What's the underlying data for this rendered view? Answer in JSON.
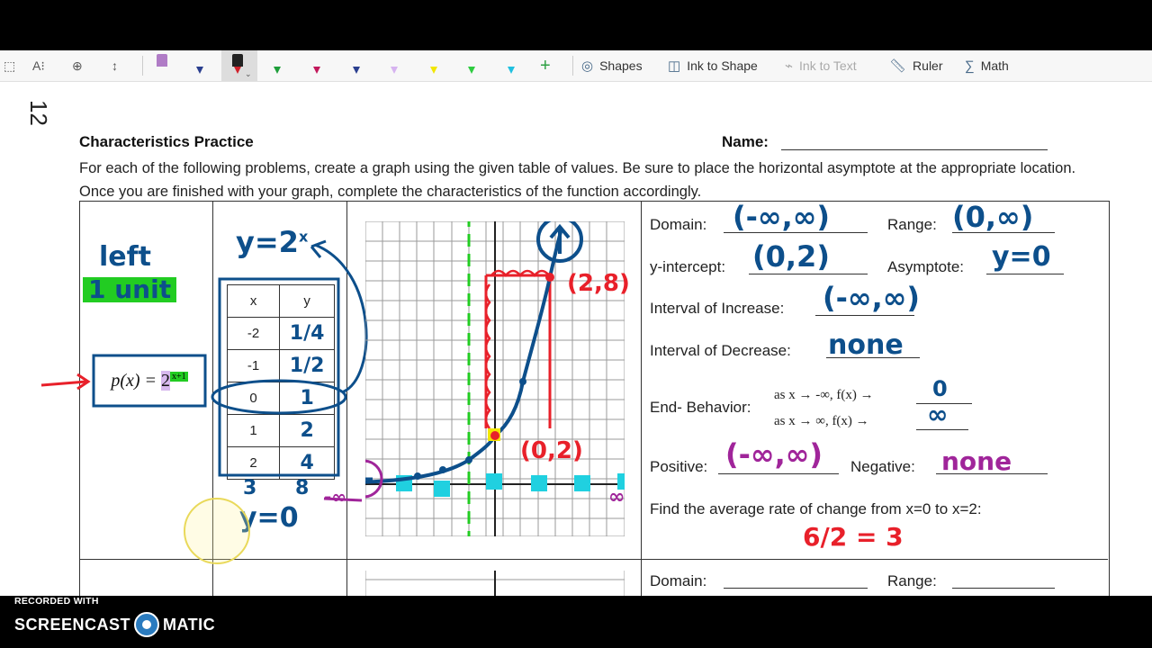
{
  "toolbar": {
    "shapes_label": "Shapes",
    "ink_to_shape_label": "Ink to Shape",
    "ink_to_text_label": "Ink to Text",
    "ruler_label": "Ruler",
    "math_label": "Math",
    "pen_colors": [
      "#b07cc6",
      "#2a3f8f",
      "#222222",
      "#1e9e3a",
      "#c2185b",
      "#2a3f8f",
      "#d6b3f0",
      "#f2e600",
      "#2ecc40",
      "#20c0e0"
    ]
  },
  "worksheet": {
    "page_number": "12",
    "title": "Characteristics Practice",
    "name_label": "Name:",
    "instructions": "For each of the following problems, create a graph using the given table of values. Be sure to place the horizontal asymptote at the appropriate location. Once you are finished with your graph, complete the characteristics of the function accordingly.",
    "function_label": "p(x) = 2",
    "function_exponent": "x+1",
    "table": {
      "headers": [
        "x",
        "y"
      ],
      "rows": [
        {
          "x": "-2",
          "y": "1/4"
        },
        {
          "x": "-1",
          "y": "1/2"
        },
        {
          "x": "0",
          "y": "1"
        },
        {
          "x": "1",
          "y": "2"
        },
        {
          "x": "2",
          "y": "4"
        }
      ],
      "extra_row": {
        "x": "3",
        "y": "8"
      }
    },
    "annotations": {
      "shift_note_1": "left",
      "shift_note_2": "1 unit",
      "parent_function": "y=2",
      "parent_exponent": "x",
      "asymptote_note": "y=0",
      "point_top": "(2,8)",
      "point_intercept": "(0,2)",
      "neg_inf": "-∞",
      "pos_inf": "∞"
    },
    "characteristics": {
      "domain_label": "Domain:",
      "domain_value": "(-∞,∞)",
      "range_label": "Range:",
      "range_value": "(0,∞)",
      "yint_label": "y-intercept:",
      "yint_value": "(0,2)",
      "asymptote_label": "Asymptote:",
      "asymptote_value": "y=0",
      "increase_label": "Interval of Increase:",
      "increase_value": "(-∞,∞)",
      "decrease_label": "Interval of Decrease:",
      "decrease_value": "none",
      "end_behavior_label": "End- Behavior:",
      "end_line1": "as x → -∞, f(x) →",
      "end_value1": "0",
      "end_line2": "as x → ∞, f(x) →",
      "end_value2": "∞",
      "positive_label": "Positive:",
      "positive_value": "(-∞,∞)",
      "negative_label": "Negative:",
      "negative_value": "none",
      "avg_rate_label": "Find the average rate of change from x=0 to x=2:",
      "avg_rate_value": "6/2 = 3"
    },
    "next_problem": {
      "domain_label": "Domain:",
      "range_label": "Range:"
    }
  },
  "recorder": {
    "recorded_with": "RECORDED WITH",
    "brand_left": "SCREENCAST",
    "brand_right": "MATIC"
  },
  "colors": {
    "ink_blue": "#0d4f8b",
    "ink_red": "#e8202a",
    "ink_purple": "#a0259a",
    "highlight_green": "#22cc22",
    "highlight_cyan": "#20d0e0"
  }
}
